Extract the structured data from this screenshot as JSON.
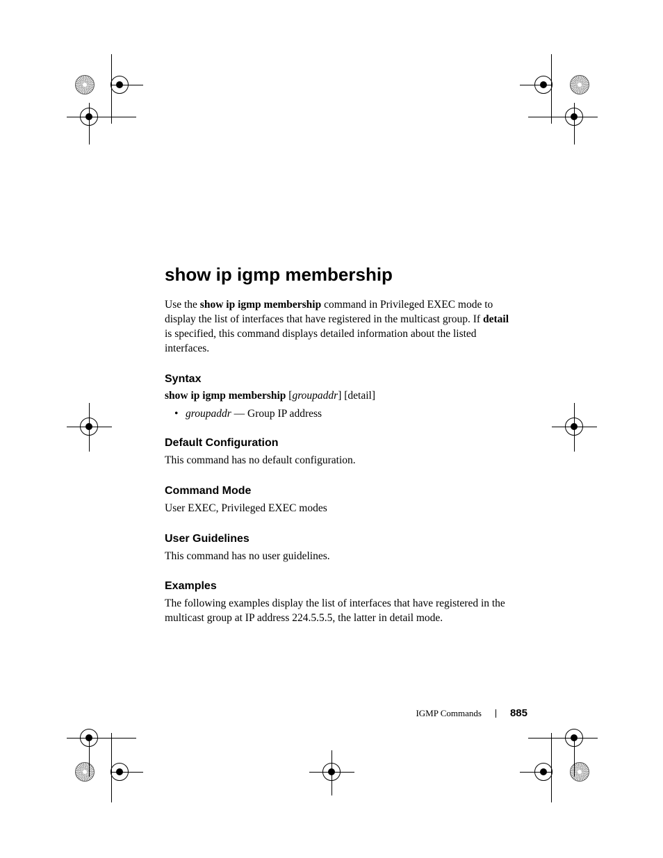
{
  "title": "show ip igmp membership",
  "intro": {
    "prefix": "Use the ",
    "cmd": "show ip igmp membership",
    "mid1": " command in Privileged EXEC mode to display the list of interfaces that have registered in the multicast group. If ",
    "detail": "detail",
    "suffix": " is specified, this command displays detailed information about the listed interfaces."
  },
  "sections": {
    "syntax": {
      "heading": "Syntax",
      "cmd": "show ip igmp membership",
      "arg1": "groupaddr",
      "arg2": "detail",
      "bullet_param": "groupaddr",
      "bullet_desc": " — Group IP address"
    },
    "default_config": {
      "heading": "Default Configuration",
      "body": "This command has no default configuration."
    },
    "command_mode": {
      "heading": "Command Mode",
      "body": "User EXEC, Privileged EXEC modes"
    },
    "user_guidelines": {
      "heading": "User Guidelines",
      "body": "This command has no user guidelines."
    },
    "examples": {
      "heading": "Examples",
      "body": "The following examples display the list of interfaces that have registered in the multicast group at IP address 224.5.5.5, the latter in detail mode."
    }
  },
  "footer": {
    "section": "IGMP Commands",
    "page": "885"
  }
}
